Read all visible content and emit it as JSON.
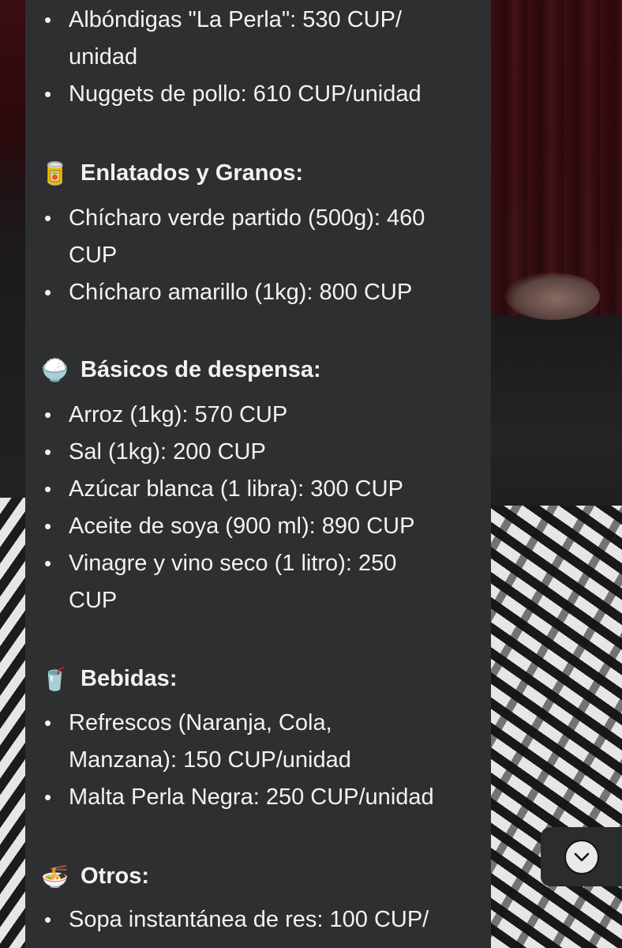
{
  "sections": [
    {
      "heading": "",
      "icon": "",
      "items": [
        "Albóndigas \"La Perla\": 530 CUP/ unidad",
        "Nuggets de pollo: 610 CUP/unidad"
      ]
    },
    {
      "heading": "Enlatados y Granos:",
      "icon": "🥫",
      "items": [
        "Chícharo verde partido (500g): 460 CUP",
        "Chícharo amarillo (1kg): 800 CUP"
      ]
    },
    {
      "heading": "Básicos de despensa:",
      "icon": "🍚",
      "items": [
        "Arroz (1kg): 570 CUP",
        "Sal (1kg): 200 CUP",
        "Azúcar blanca (1 libra): 300 CUP",
        "Aceite de soya (900 ml): 890 CUP",
        "Vinagre y vino seco (1 litro): 250 CUP"
      ]
    },
    {
      "heading": "Bebidas:",
      "icon": "🥤",
      "items": [
        "Refrescos (Naranja, Cola, Manzana): 150 CUP/unidad",
        "Malta Perla Negra: 250 CUP/unidad"
      ]
    },
    {
      "heading": "Otros:",
      "icon": "🍜",
      "items": [
        "Sopa instantánea de res: 100 CUP/"
      ]
    }
  ],
  "scroll_button": {
    "icon": "chevron-down-circle-icon",
    "glyph": "⌄"
  }
}
